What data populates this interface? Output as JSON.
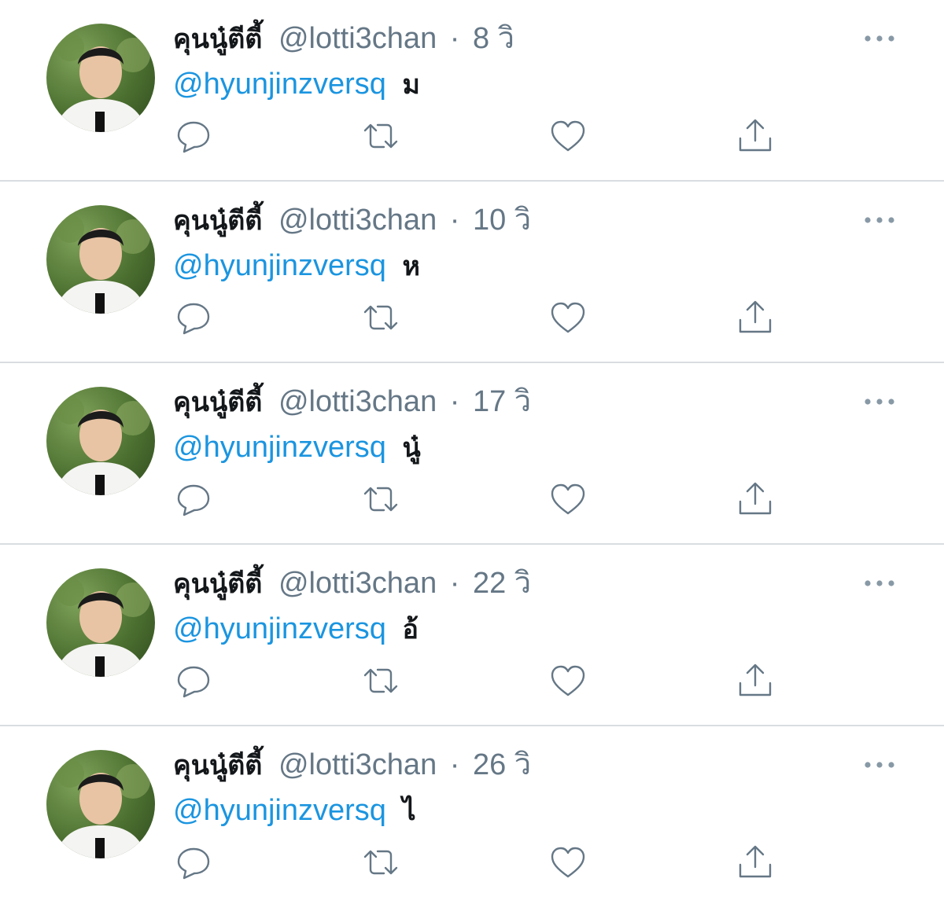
{
  "colors": {
    "name": "#14171a",
    "secondary": "#657786",
    "mention": "#1b95e0",
    "divider": "#d9dde1"
  },
  "icons": {
    "reply": "reply-bubble-icon",
    "retweet": "retweet-arrows-icon",
    "like": "heart-outline-icon",
    "share": "share-upload-icon",
    "more": "more-horizontal-icon"
  },
  "tweets": [
    {
      "display_name": "คุนนู๋ตีตี้",
      "handle": "@lotti3chan",
      "separator": "·",
      "time": "8 วิ",
      "mention": "@hyunjinzversq",
      "text": "ม"
    },
    {
      "display_name": "คุนนู๋ตีตี้",
      "handle": "@lotti3chan",
      "separator": "·",
      "time": "10 วิ",
      "mention": "@hyunjinzversq",
      "text": "ห"
    },
    {
      "display_name": "คุนนู๋ตีตี้",
      "handle": "@lotti3chan",
      "separator": "·",
      "time": "17 วิ",
      "mention": "@hyunjinzversq",
      "text": "นู๋"
    },
    {
      "display_name": "คุนนู๋ตีตี้",
      "handle": "@lotti3chan",
      "separator": "·",
      "time": "22 วิ",
      "mention": "@hyunjinzversq",
      "text": "อ้"
    },
    {
      "display_name": "คุนนู๋ตีตี้",
      "handle": "@lotti3chan",
      "separator": "·",
      "time": "26 วิ",
      "mention": "@hyunjinzversq",
      "text": "ไ"
    }
  ]
}
